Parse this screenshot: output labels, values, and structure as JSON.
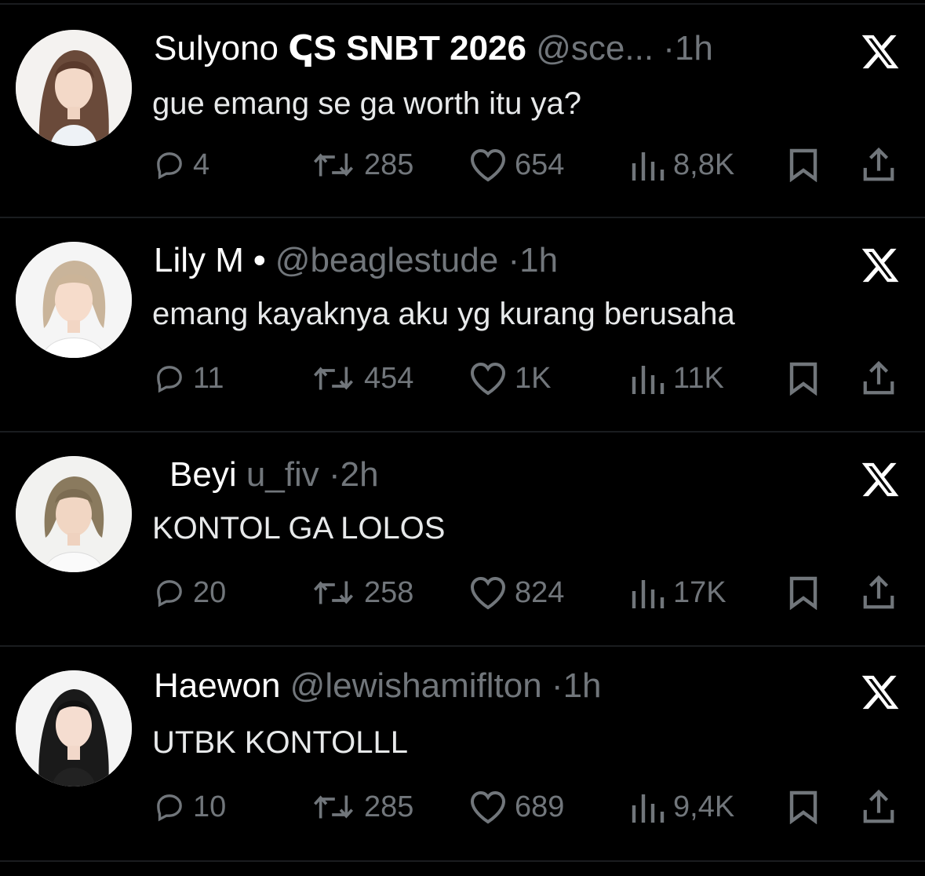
{
  "tweets": [
    {
      "name": "Sulyono",
      "name_extra": "ↅS SNBT 2026",
      "handle": "@sce...",
      "sep": "·",
      "time": "1h",
      "text": "gue emang se ga worth itu ya?",
      "replies": "4",
      "retweets": "285",
      "likes": "654",
      "views": "8,8K"
    },
    {
      "name": "Lily M",
      "name_extra": "•",
      "handle": "@beaglestude",
      "sep": "·",
      "time": "1h",
      "text": "emang kayaknya aku yg kurang berusaha",
      "replies": "11",
      "retweets": "454",
      "likes": "1K",
      "views": "11K"
    },
    {
      "name": "Beyi",
      "name_extra": "",
      "handle": "u_fiv",
      "sep": "·",
      "time": "2h",
      "text": "KONTOL GA LOLOS",
      "replies": "20",
      "retweets": "258",
      "likes": "824",
      "views": "17K"
    },
    {
      "name": "Haewon",
      "name_extra": "",
      "handle": "@lewishamiflton",
      "sep": "·",
      "time": "1h",
      "text": "UTBK KONTOLLL",
      "replies": "10",
      "retweets": "285",
      "likes": "689",
      "views": "9,4K"
    }
  ],
  "icons": {
    "reply": "reply-icon",
    "retweet": "retweet-icon",
    "like": "like-icon",
    "views": "views-icon",
    "bookmark": "bookmark-icon",
    "share": "share-icon",
    "source": "x-logo-icon"
  },
  "colors": {
    "background": "#000000",
    "text": "#e7e9ea",
    "muted": "#71767b",
    "divider": "#1a1c1f"
  }
}
